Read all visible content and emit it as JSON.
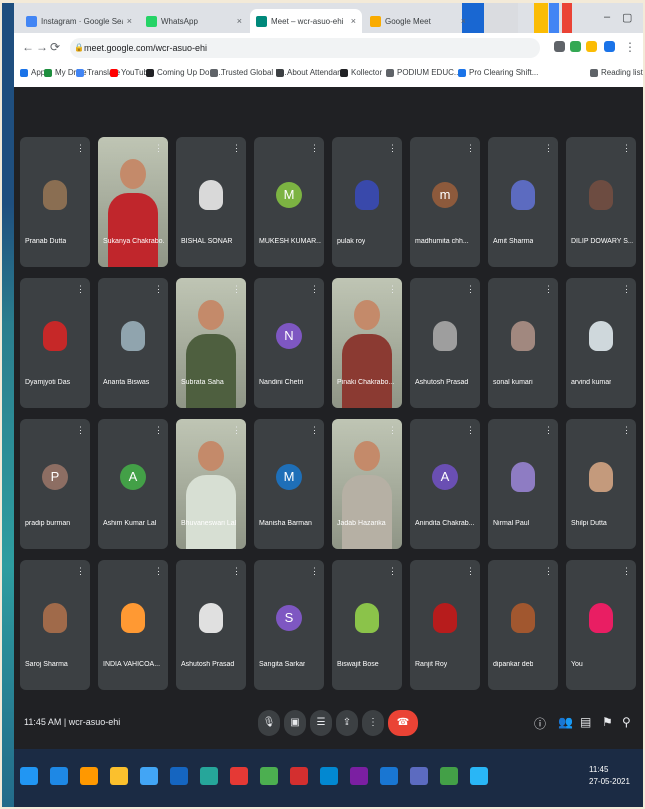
{
  "colors": {
    "meet_bg": "#202124",
    "tile_bg": "#3c4043",
    "end_call": "#ea4335",
    "tab_strip": "#dee1e6"
  },
  "tabs": [
    {
      "label": "Instagram · Google Search",
      "favicon": "#4285f4",
      "active": false
    },
    {
      "label": "WhatsApp",
      "favicon": "#25d366",
      "active": false
    },
    {
      "label": "Meet – wcr-asuo-ehi",
      "favicon": "#00897b",
      "active": true
    },
    {
      "label": "Google Meet",
      "favicon": "#f9ab00",
      "active": false
    }
  ],
  "address": {
    "url": "meet.google.com/wcr-asuo-ehi"
  },
  "bookmarks": [
    {
      "label": "Apps",
      "icon": "#1a73e8"
    },
    {
      "label": "My Drive",
      "icon": "#1e8e3e"
    },
    {
      "label": "Translate",
      "icon": "#4285f4"
    },
    {
      "label": "YouTube",
      "icon": "#ff0000"
    },
    {
      "label": "Coming Up Dom...",
      "icon": "#202124"
    },
    {
      "label": "Trusted Global L...",
      "icon": "#5f6368"
    },
    {
      "label": "About Attendan...",
      "icon": "#3c4043"
    },
    {
      "label": "Kollector",
      "icon": "#202124"
    },
    {
      "label": "PODIUM EDUC...",
      "icon": "#5f6368"
    },
    {
      "label": "Pro Clearing Shift...",
      "icon": "#1a73e8"
    },
    {
      "label": "Reading list",
      "icon": "#5f6368"
    }
  ],
  "participants": [
    {
      "name": "Pranab Dutta",
      "kind": "photo",
      "color": "#8a6e52"
    },
    {
      "name": "Sukanya Chakrabo...",
      "kind": "video",
      "color": "#c0262c"
    },
    {
      "name": "BISHAL SONAR",
      "kind": "photo",
      "color": "#d9d9d9"
    },
    {
      "name": "MUKESH KUMAR...",
      "kind": "letter",
      "letter": "M",
      "color": "#7cb342"
    },
    {
      "name": "pulak roy",
      "kind": "photo",
      "color": "#3949ab"
    },
    {
      "name": "madhumita chh...",
      "kind": "letter",
      "letter": "m",
      "color": "#8d5a3c"
    },
    {
      "name": "Amit Sharma",
      "kind": "photo",
      "color": "#5c6bc0"
    },
    {
      "name": "DILIP DOWARY S...",
      "kind": "photo",
      "color": "#6d4c41"
    },
    {
      "name": "Dyamjyoti Das",
      "kind": "photo",
      "color": "#c62828"
    },
    {
      "name": "Ananta Biswas",
      "kind": "photo",
      "color": "#90a4ae"
    },
    {
      "name": "Subrata Saha",
      "kind": "video",
      "color": "#4e5f3f"
    },
    {
      "name": "Nandini Chetri",
      "kind": "letter",
      "letter": "N",
      "color": "#7e57c2"
    },
    {
      "name": "Pinaki Chakrabo...",
      "kind": "video",
      "color": "#8b3a32"
    },
    {
      "name": "Ashutosh Prasad",
      "kind": "photo",
      "color": "#9e9e9e"
    },
    {
      "name": "sonal kumari",
      "kind": "photo",
      "color": "#a1887f"
    },
    {
      "name": "arvind kumar",
      "kind": "photo",
      "color": "#cfd8dc"
    },
    {
      "name": "pradip burman",
      "kind": "letter",
      "letter": "P",
      "color": "#8d6e63"
    },
    {
      "name": "Ashim Kumar Lal",
      "kind": "letter",
      "letter": "A",
      "color": "#43a047"
    },
    {
      "name": "Bhuvaneswari Lal",
      "kind": "video",
      "color": "#d7dfd3"
    },
    {
      "name": "Manisha Barman",
      "kind": "letter",
      "letter": "M",
      "color": "#1e6fb8"
    },
    {
      "name": "Jadab Hazarika",
      "kind": "video",
      "color": "#b6b0a4"
    },
    {
      "name": "Anindita Chakrab...",
      "kind": "letter",
      "letter": "A",
      "color": "#6a4fb3"
    },
    {
      "name": "Nirmal Paul",
      "kind": "photo",
      "color": "#8e7cc3"
    },
    {
      "name": "Shilpi Dutta",
      "kind": "photo",
      "color": "#c49a7c"
    },
    {
      "name": "Saroj Sharma",
      "kind": "photo",
      "color": "#a06a4a"
    },
    {
      "name": "INDIA VAHICOA...",
      "kind": "photo",
      "color": "#ff9933"
    },
    {
      "name": "Ashutosh Prasad",
      "kind": "photo",
      "color": "#e0e0e0"
    },
    {
      "name": "Sangita Sarkar",
      "kind": "letter",
      "letter": "S",
      "color": "#7e57c2"
    },
    {
      "name": "Biswajit Bose",
      "kind": "photo",
      "color": "#8bc34a"
    },
    {
      "name": "Ranjit Roy",
      "kind": "photo",
      "color": "#b71c1c"
    },
    {
      "name": "dipankar deb",
      "kind": "photo",
      "color": "#a1572f"
    },
    {
      "name": "You",
      "kind": "photo",
      "color": "#e91e63"
    }
  ],
  "bottom": {
    "meeting_info": "11:45 AM | wcr-asuo-ehi",
    "controls": [
      "mic",
      "camera",
      "captions",
      "present",
      "more",
      "end"
    ]
  },
  "taskbar": {
    "time": "11:45",
    "date": "27-05-2021"
  }
}
